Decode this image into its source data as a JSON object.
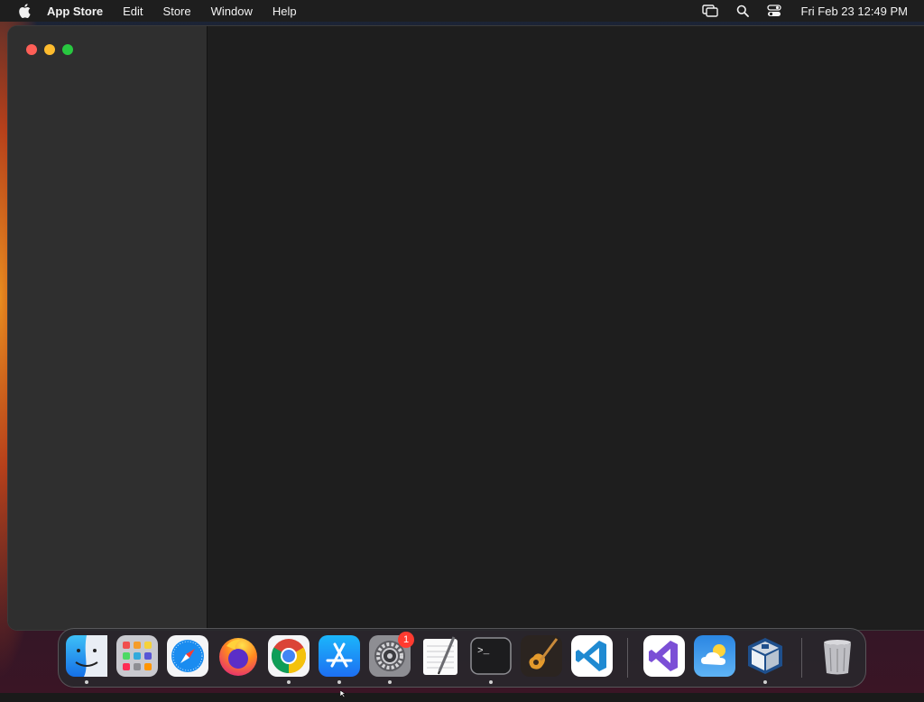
{
  "menubar": {
    "apple_icon": "apple-logo",
    "app_name": "App Store",
    "items": [
      "Edit",
      "Store",
      "Window",
      "Help"
    ],
    "status_icons": [
      "screen-mirroring-icon",
      "search-icon",
      "control-center-icon"
    ],
    "clock": "Fri Feb 23  12:49 PM"
  },
  "window": {
    "traffic_lights": [
      "close",
      "minimize",
      "maximize"
    ]
  },
  "dock": {
    "apps": [
      {
        "name": "Finder",
        "icon": "finder-icon",
        "running": true
      },
      {
        "name": "Launchpad",
        "icon": "launchpad-icon",
        "running": false
      },
      {
        "name": "Safari",
        "icon": "safari-icon",
        "running": false
      },
      {
        "name": "Firefox",
        "icon": "firefox-icon",
        "running": false
      },
      {
        "name": "Google Chrome",
        "icon": "chrome-icon",
        "running": true
      },
      {
        "name": "App Store",
        "icon": "app-store-icon",
        "running": true
      },
      {
        "name": "System Settings",
        "icon": "system-settings-icon",
        "running": true,
        "badge": "1"
      },
      {
        "name": "TextEdit",
        "icon": "textedit-icon",
        "running": false
      },
      {
        "name": "Terminal",
        "icon": "terminal-icon",
        "running": true
      },
      {
        "name": "GarageBand",
        "icon": "garageband-icon",
        "running": false
      },
      {
        "name": "Visual Studio Code",
        "icon": "vscode-icon",
        "running": false
      },
      {
        "name": "Visual Studio",
        "icon": "visual-studio-icon",
        "running": false
      },
      {
        "name": "Weather",
        "icon": "weather-icon",
        "running": false
      },
      {
        "name": "VirtualBox",
        "icon": "virtualbox-icon",
        "running": true
      },
      {
        "name": "Trash",
        "icon": "trash-icon",
        "running": false
      }
    ],
    "settings_badge": "1"
  }
}
